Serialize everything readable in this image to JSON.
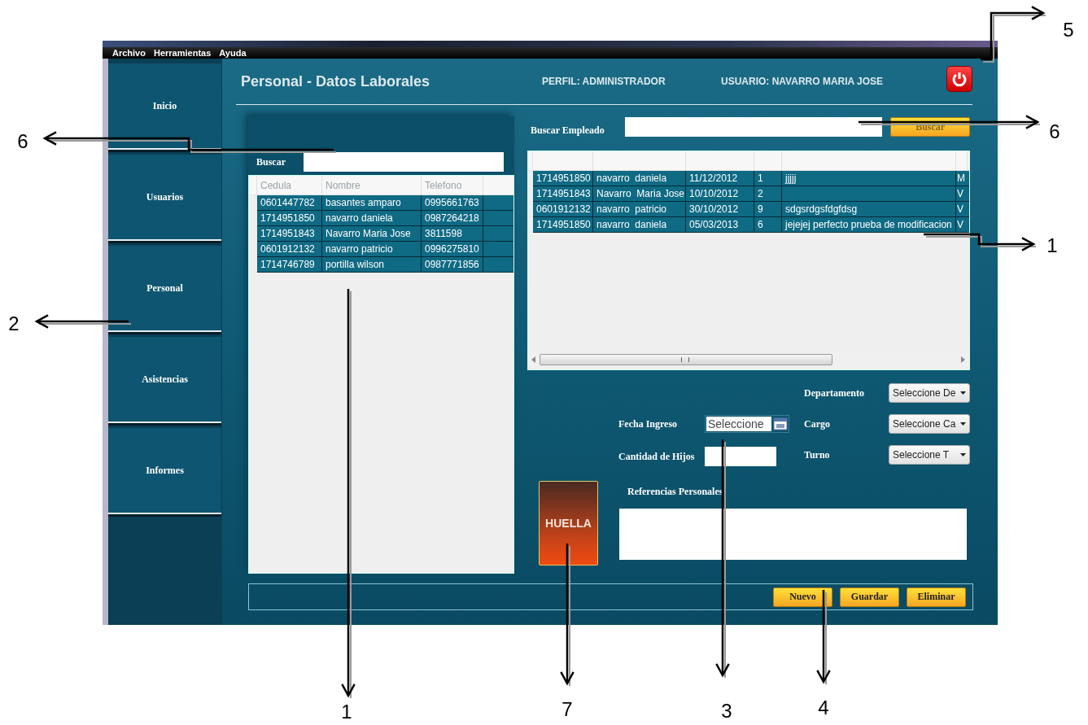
{
  "menu": [
    {
      "label": "Archivo"
    },
    {
      "label": "Herramientas"
    },
    {
      "label": "Ayuda"
    }
  ],
  "sidebar": {
    "items": [
      {
        "label": "Inicio"
      },
      {
        "label": "Usuarios"
      },
      {
        "label": "Personal"
      },
      {
        "label": "Asistencias"
      },
      {
        "label": "Informes"
      }
    ]
  },
  "header": {
    "title": "Personal - Datos Laborales",
    "profile": "PERFIL: ADMINISTRADOR",
    "user": "USUARIO: NAVARRO MARIA JOSE"
  },
  "person_list": {
    "search_label": "Buscar",
    "columns": [
      "Cedula",
      "Nombre",
      "Telefono"
    ],
    "rows": [
      [
        "0601447782",
        "basantes amparo",
        "0995661763"
      ],
      [
        "1714951850",
        "navarro daniela",
        "0987264218"
      ],
      [
        "1714951843",
        "Navarro Maria Jose",
        "3811598"
      ],
      [
        "0601912132",
        "navarro patricio",
        "0996275810"
      ],
      [
        "1714746789",
        "portilla wilson",
        "0987771856"
      ]
    ]
  },
  "employee_search": {
    "label": "Buscar Empleado",
    "button": "Buscar"
  },
  "employee_table": {
    "rows": [
      {
        "column_1": "1714951850",
        "column_2": "navarro  daniela",
        "column_3": "11/12/2012",
        "column_4": "1",
        "column_5": "jjjjj",
        "column_6": "M"
      },
      {
        "column_1": "1714951843",
        "column_2": "Navarro  Maria Jose",
        "column_3": "10/10/2012",
        "column_4": "2",
        "column_6": "V"
      },
      {
        "column_1": "0601912132",
        "column_2": "navarro  patricio",
        "column_3": "30/10/2012",
        "column_4": "9",
        "column_5": "sdgsrdgsfdgfdsg",
        "column_6": "V"
      },
      {
        "column_1": "1714951850",
        "column_2": "navarro  daniela",
        "column_3": "05/03/2013",
        "column_4": "6",
        "column_5": "jejejej perfecto prueba de modificacion",
        "column_6": "V"
      }
    ]
  },
  "form": {
    "left_fields": [
      {
        "label": "Fecha Ingreso",
        "kind": "date",
        "value": "Seleccione"
      },
      {
        "label": "Cantidad de Hijos",
        "kind": "text"
      }
    ],
    "right_fields": [
      {
        "label": "Departamento",
        "kind": "select",
        "value": "Seleccione De"
      },
      {
        "label": "Cargo",
        "kind": "select",
        "value": "Seleccione Ca"
      },
      {
        "label": "Turno",
        "kind": "select",
        "value": "Seleccione T"
      }
    ]
  },
  "fingerprint_button": {
    "label": "HUELLA"
  },
  "references": {
    "label": "Referencias Personales"
  },
  "actions": [
    {
      "label": "Nuevo"
    },
    {
      "label": "Guardar"
    },
    {
      "label": "Eliminar"
    }
  ],
  "callouts": [
    {
      "number": "5"
    },
    {
      "number": "6"
    },
    {
      "number": "6"
    },
    {
      "number": "1"
    },
    {
      "number": "2"
    },
    {
      "number": "1"
    },
    {
      "number": "7"
    },
    {
      "number": "3"
    },
    {
      "number": "4"
    }
  ]
}
